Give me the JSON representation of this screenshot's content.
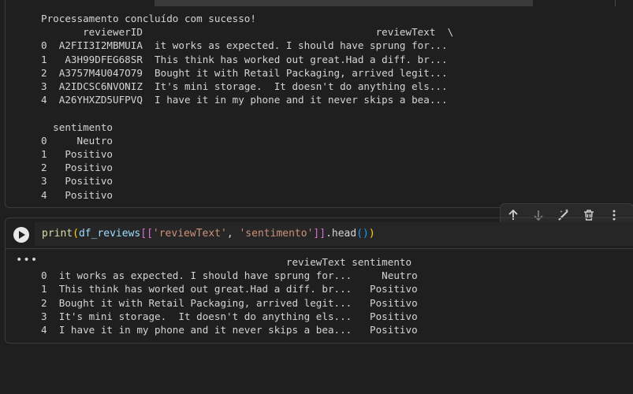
{
  "cell1": {
    "output_lines": [
      "Processamento concluído com sucesso!",
      "       reviewerID                                       reviewText  \\",
      "0  A2FII3I2MBMUIA  it works as expected. I should have sprung for...",
      "1   A3H99DFEG68SR  This think has worked out great.Had a diff. br...",
      "2  A3757M4U047O79  Bought it with Retail Packaging, arrived legit...",
      "3  A2IDCSC6NVONIZ  It's mini storage.  It doesn't do anything els...",
      "4  A26YHXZD5UFPVQ  I have it in my phone and it never skips a bea...",
      "",
      "  sentimento",
      "0     Neutro",
      "1   Positivo",
      "2   Positivo",
      "3   Positivo",
      "4   Positivo"
    ]
  },
  "cell2": {
    "code": {
      "fn": "print",
      "open": "(",
      "var": "df_reviews",
      "br_open": "[[",
      "str1": "'reviewText'",
      "comma": ", ",
      "str2": "'sentimento'",
      "br_close": "]]",
      "method": ".head",
      "call": "()",
      "close": ")"
    },
    "output_lines": [
      "                                         reviewText sentimento",
      "0  it works as expected. I should have sprung for...     Neutro",
      "1  This think has worked out great.Had a diff. br...   Positivo",
      "2  Bought it with Retail Packaging, arrived legit...   Positivo",
      "3  It's mini storage.  It doesn't do anything els...   Positivo",
      "4  I have it in my phone and it never skips a bea...   Positivo"
    ],
    "output_menu": "•••"
  },
  "toolbar": {
    "icons": [
      "arrow-up-icon",
      "arrow-down-icon",
      "edit-magic-icon",
      "trash-icon",
      "more-vertical-icon"
    ]
  }
}
